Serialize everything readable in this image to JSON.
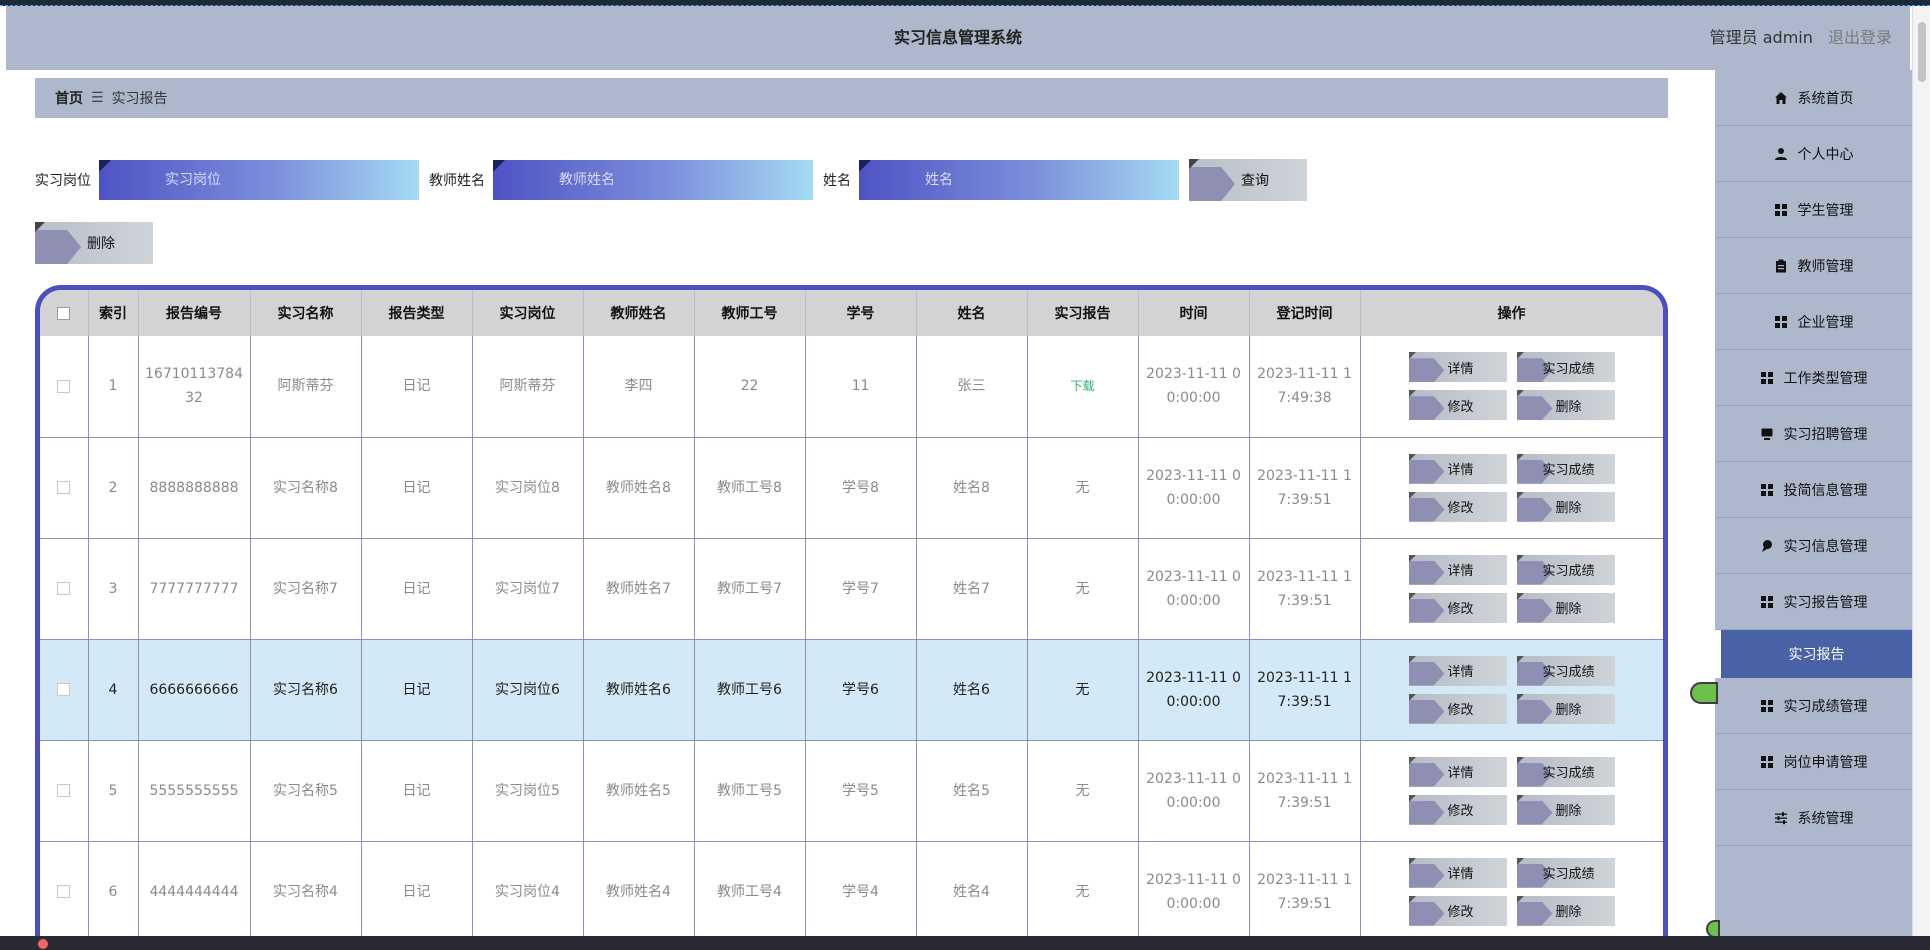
{
  "header": {
    "title": "实习信息管理系统",
    "user": "管理员 admin",
    "logout": "退出登录"
  },
  "breadcrumb": {
    "home": "首页",
    "sep": "☰",
    "current": "实习报告"
  },
  "search": {
    "fields": [
      {
        "label": "实习岗位",
        "placeholder": "实习岗位"
      },
      {
        "label": "教师姓名",
        "placeholder": "教师姓名"
      },
      {
        "label": "姓名",
        "placeholder": "姓名"
      }
    ],
    "query_label": "查询",
    "delete_label": "删除"
  },
  "sidebar": {
    "items": [
      {
        "label": "系统首页",
        "icon": "home-icon"
      },
      {
        "label": "个人中心",
        "icon": "user-icon"
      },
      {
        "label": "学生管理",
        "icon": "grid-icon"
      },
      {
        "label": "教师管理",
        "icon": "clipboard-icon"
      },
      {
        "label": "企业管理",
        "icon": "grid-icon"
      },
      {
        "label": "工作类型管理",
        "icon": "grid-icon"
      },
      {
        "label": "实习招聘管理",
        "icon": "monitor-icon"
      },
      {
        "label": "投简信息管理",
        "icon": "grid-icon"
      },
      {
        "label": "实习信息管理",
        "icon": "pin-icon"
      },
      {
        "label": "实习报告管理",
        "icon": "grid-icon"
      }
    ],
    "active_sub": "实习报告",
    "items_after": [
      {
        "label": "实习成绩管理",
        "icon": "grid-icon"
      },
      {
        "label": "岗位申请管理",
        "icon": "grid-icon"
      },
      {
        "label": "系统管理",
        "icon": "sliders-icon"
      }
    ]
  },
  "table": {
    "columns": [
      "索引",
      "报告编号",
      "实习名称",
      "报告类型",
      "实习岗位",
      "教师姓名",
      "教师工号",
      "学号",
      "姓名",
      "实习报告",
      "时间",
      "登记时间",
      "操作"
    ],
    "rows": [
      {
        "index": "1",
        "report_no": "1671011378432",
        "name": "阿斯蒂芬",
        "type": "日记",
        "post": "阿斯蒂芬",
        "teacher": "李四",
        "teacher_no": "22",
        "student_no": "11",
        "student": "张三",
        "report": "下载",
        "time": "2023-11-11 00:00:00",
        "reg_time": "2023-11-11 17:49:38"
      },
      {
        "index": "2",
        "report_no": "8888888888",
        "name": "实习名称8",
        "type": "日记",
        "post": "实习岗位8",
        "teacher": "教师姓名8",
        "teacher_no": "教师工号8",
        "student_no": "学号8",
        "student": "姓名8",
        "report": "无",
        "time": "2023-11-11 00:00:00",
        "reg_time": "2023-11-11 17:39:51"
      },
      {
        "index": "3",
        "report_no": "7777777777",
        "name": "实习名称7",
        "type": "日记",
        "post": "实习岗位7",
        "teacher": "教师姓名7",
        "teacher_no": "教师工号7",
        "student_no": "学号7",
        "student": "姓名7",
        "report": "无",
        "time": "2023-11-11 00:00:00",
        "reg_time": "2023-11-11 17:39:51"
      },
      {
        "index": "4",
        "report_no": "6666666666",
        "name": "实习名称6",
        "type": "日记",
        "post": "实习岗位6",
        "teacher": "教师姓名6",
        "teacher_no": "教师工号6",
        "student_no": "学号6",
        "student": "姓名6",
        "report": "无",
        "time": "2023-11-11 00:00:00",
        "reg_time": "2023-11-11 17:39:51"
      },
      {
        "index": "5",
        "report_no": "5555555555",
        "name": "实习名称5",
        "type": "日记",
        "post": "实习岗位5",
        "teacher": "教师姓名5",
        "teacher_no": "教师工号5",
        "student_no": "学号5",
        "student": "姓名5",
        "report": "无",
        "time": "2023-11-11 00:00:00",
        "reg_time": "2023-11-11 17:39:51"
      },
      {
        "index": "6",
        "report_no": "4444444444",
        "name": "实习名称4",
        "type": "日记",
        "post": "实习岗位4",
        "teacher": "教师姓名4",
        "teacher_no": "教师工号4",
        "student_no": "学号4",
        "student": "姓名4",
        "report": "无",
        "time": "2023-11-11 00:00:00",
        "reg_time": "2023-11-11 17:39:51"
      }
    ],
    "actions": {
      "detail": "详情",
      "score": "实习成绩",
      "edit": "修改",
      "delete": "删除"
    },
    "highlight_row": 3
  },
  "colors": {
    "header_bg": "#aeb8cc",
    "active_menu": "#4962a6",
    "table_border": "#4b4fc2",
    "highlight_row": "#d3e9f7",
    "download": "#2ab36f"
  }
}
